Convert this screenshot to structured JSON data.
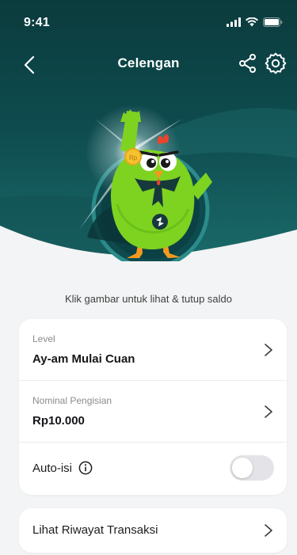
{
  "status_bar": {
    "time": "9:41"
  },
  "nav": {
    "title": "Celengan"
  },
  "hero": {
    "hint": "Klik gambar untuk lihat & tutup saldo",
    "coin_label": "Rp"
  },
  "settings_card": {
    "level": {
      "label": "Level",
      "value": "Ay-am Mulai Cuan"
    },
    "nominal": {
      "label": "Nominal Pengisian",
      "value": "Rp10.000"
    },
    "auto_fill": {
      "label": "Auto-isi",
      "enabled": false
    }
  },
  "history": {
    "label": "Lihat Riwayat Transaksi"
  },
  "colors": {
    "hero_dark": "#0b3f42",
    "hero_teal": "#1b6a6a",
    "mascot_green": "#7ed321",
    "toggle_off": "#e4e4e8"
  }
}
